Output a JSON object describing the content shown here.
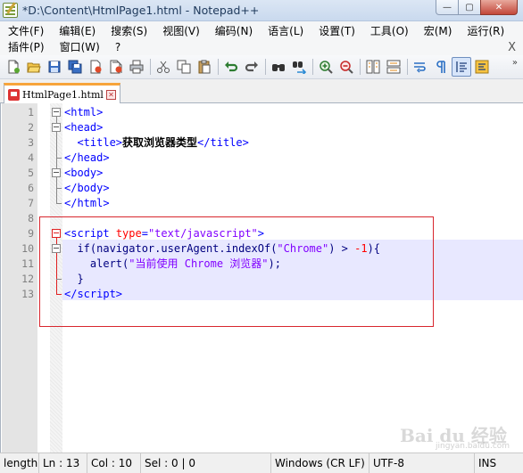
{
  "window": {
    "title": "*D:\\Content\\HtmlPage1.html - Notepad++",
    "min_glyph": "—",
    "max_glyph": "▢",
    "close_glyph": "✕"
  },
  "menu": {
    "row1": [
      "文件(F)",
      "编辑(E)",
      "搜索(S)",
      "视图(V)",
      "编码(N)",
      "语言(L)",
      "设置(T)",
      "工具(O)",
      "宏(M)",
      "运行(R)"
    ],
    "row2": [
      "插件(P)",
      "窗口(W)",
      "?"
    ],
    "close": "X"
  },
  "toolbar": {
    "buttons": [
      "new-file",
      "open-file",
      "save",
      "save-all",
      "close",
      "close-all",
      "print",
      "cut",
      "copy",
      "paste",
      "undo",
      "redo",
      "find",
      "replace",
      "zoom-in",
      "zoom-out",
      "sync-vertical",
      "sync-horizontal",
      "word-wrap",
      "show-all-chars",
      "indent-guide",
      "user-defined"
    ],
    "more": "»"
  },
  "tab": {
    "label": "HtmlPage1.html",
    "close": "✕"
  },
  "editor": {
    "line_numbers": [
      "1",
      "2",
      "3",
      "4",
      "5",
      "6",
      "7",
      "8",
      "9",
      "10",
      "11",
      "12",
      "13"
    ],
    "highlighted_line": 10
  },
  "statusbar": {
    "length": "length",
    "ln": "Ln : 13",
    "col": "Col : 10",
    "sel": "Sel : 0 | 0",
    "eol": "Windows (CR LF)",
    "encoding": "UTF-8",
    "mode": "INS"
  },
  "watermark": {
    "brand": "Bai du 经验",
    "sub": "jingyan.baidu.com"
  },
  "colors": {
    "tag": "#0000ff",
    "attr": "#ff0000",
    "string": "#8000ff",
    "annotation_box": "#d8262e",
    "active_tab_accent": "#f7a43b"
  }
}
